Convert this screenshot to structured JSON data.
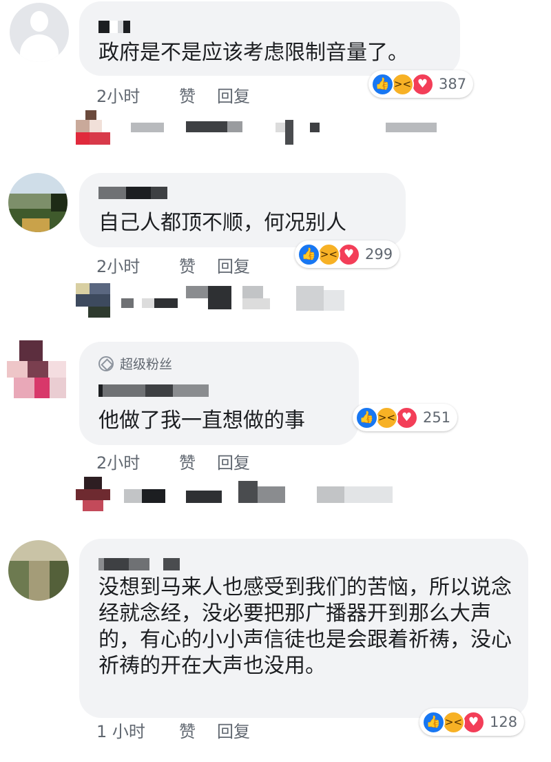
{
  "comments": [
    {
      "text": "政府是不是应该考虑限制音量了。",
      "time": "2小时",
      "like_label": "赞",
      "reply_label": "回复",
      "reaction_count": "387"
    },
    {
      "text": "自己人都顶不顺，何况别人",
      "time": "2小时",
      "like_label": "赞",
      "reply_label": "回复",
      "reaction_count": "299"
    },
    {
      "badge": "超级粉丝",
      "text": "他做了我一直想做的事",
      "time": "2小时",
      "like_label": "赞",
      "reply_label": "回复",
      "reaction_count": "251"
    },
    {
      "text": "没想到马来人也感受到我们的苦恼，所以说念经就念经，没必要把那广播器开到那么大声的，有心的小小声信徒也是会跟着祈祷，没心祈祷的开在大声也没用。",
      "time": "1 小时",
      "like_label": "赞",
      "reply_label": "回复",
      "reaction_count": "128"
    }
  ],
  "icons": {
    "like": "thumbs-up-icon",
    "haha": "laughing-face-icon",
    "love": "heart-icon",
    "badge": "diamond-icon"
  },
  "colors": {
    "bubble": "#f2f3f5",
    "like": "#1877f2",
    "haha": "#f7b125",
    "love": "#f33e58",
    "meta_text": "#606770"
  }
}
